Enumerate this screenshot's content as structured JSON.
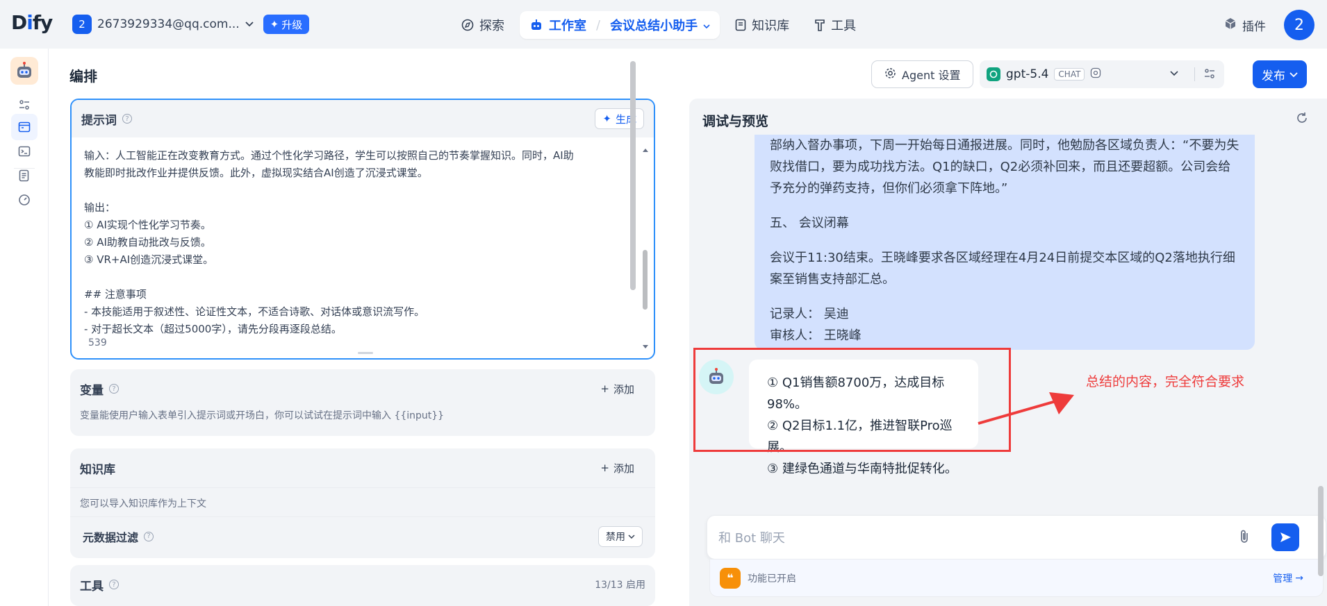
{
  "brand": {
    "logo": "Dify",
    "logo_prefix": "D",
    "logo_dot": "i",
    "logo_suffix": "fy"
  },
  "workspace": {
    "badge": "2",
    "name": "2673929334@qq.com...",
    "upgrade_label": "升级"
  },
  "nav": {
    "explore": "探索",
    "studio": "工作室",
    "app_name": "会议总结小助手",
    "knowledge": "知识库",
    "tools": "工具",
    "plugins": "插件",
    "avatar": "2"
  },
  "main": {
    "title": "编排",
    "agent_settings": "Agent 设置",
    "model": {
      "name": "gpt-5.4",
      "tag": "CHAT"
    },
    "publish": "发布"
  },
  "prompt": {
    "title": "提示词",
    "generate": "生成",
    "lines": [
      "输入：人工智能正在改变教育方式。通过个性化学习路径，学生可以按照自己的节奏掌握知识。同时，AI助",
      "教能即时批改作业并提供反馈。此外，虚拟现实结合AI创造了沉浸式课堂。",
      "",
      "输出：",
      "① AI实现个性化学习节奏。",
      "② AI助教自动批改与反馈。",
      "③ VR+AI创造沉浸式课堂。",
      "",
      "## 注意事项",
      "- 本技能适用于叙述性、论证性文本，不适合诗歌、对话体或意识流写作。",
      "- 对于超长文本（超过5000字），请先分段再逐段总结。"
    ],
    "char_count": "539"
  },
  "variables": {
    "title": "变量",
    "add": "添加",
    "desc": "变量能使用户输入表单引入提示词或开场白，你可以试试在提示词中输入 {{input}}"
  },
  "knowledge": {
    "title": "知识库",
    "add": "添加",
    "desc": "您可以导入知识库作为上下文",
    "metadata_filter": "元数据过滤",
    "filter_value": "禁用"
  },
  "tools": {
    "title": "工具",
    "count": "13/13 启用"
  },
  "debug": {
    "title": "调试与预览",
    "user_message": [
      "部纳入督办事项，下周一开始每日通报进展。同时，他勉励各区域负责人：“不要为失败找借口，要为成功找方法。Q1的缺口，Q2必须补回来，而且还要超额。公司会给予充分的弹药支持，但你们必须拿下阵地。”",
      "五、 会议闭幕",
      "会议于11:30结束。王晓峰要求各区域经理在4月24日前提交本区域的Q2落地执行细案至销售支持部汇总。",
      "记录人： 吴迪\n审核人： 王晓峰"
    ],
    "bot_lines": [
      "① Q1销售额8700万，达成目标98%。",
      "② Q2目标1.1亿，推进智联Pro巡展。",
      "③ 建绿色通道与华南特批促转化。"
    ],
    "annotation": "总结的内容，完全符合要求",
    "input_placeholder": "和 Bot 聊天",
    "features_enabled": "功能已开启",
    "manage": "管理"
  },
  "colors": {
    "accent": "#155eef",
    "annotation": "#ee3b3b",
    "user_bubble": "#d1e0ff"
  }
}
